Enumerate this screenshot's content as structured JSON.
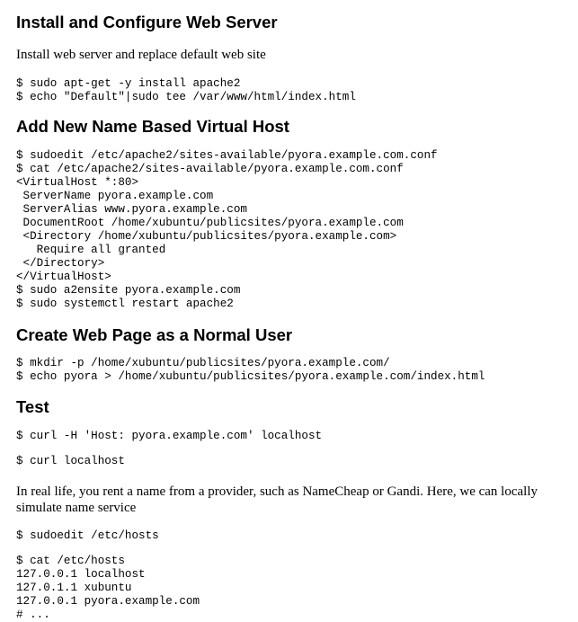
{
  "sections": [
    {
      "heading": "Install and Configure Web Server",
      "intro": "Install web server and replace default web site",
      "code": [
        "$ sudo apt-get -y install apache2",
        "$ echo \"Default\"|sudo tee /var/www/html/index.html"
      ]
    },
    {
      "heading": "Add New Name Based Virtual Host",
      "code": [
        "$ sudoedit /etc/apache2/sites-available/pyora.example.com.conf",
        "$ cat /etc/apache2/sites-available/pyora.example.com.conf",
        "<VirtualHost *:80>",
        " ServerName pyora.example.com",
        " ServerAlias www.pyora.example.com",
        " DocumentRoot /home/xubuntu/publicsites/pyora.example.com",
        " <Directory /home/xubuntu/publicsites/pyora.example.com>",
        "   Require all granted",
        " </Directory>",
        "</VirtualHost>",
        "$ sudo a2ensite pyora.example.com",
        "$ sudo systemctl restart apache2"
      ]
    },
    {
      "heading": "Create Web Page as a Normal User",
      "code": [
        "$ mkdir -p /home/xubuntu/publicsites/pyora.example.com/",
        "$ echo pyora > /home/xubuntu/publicsites/pyora.example.com/index.html"
      ]
    },
    {
      "heading": "Test",
      "code_a": "$ curl -H 'Host: pyora.example.com' localhost",
      "code_b": "$ curl localhost",
      "paragraph": "In real life, you rent a name from a provider, such as NameCheap or Gandi. Here, we can locally simulate name service",
      "code_c": "$ sudoedit /etc/hosts",
      "code_d": [
        "$ cat /etc/hosts",
        "127.0.0.1 localhost",
        "127.0.1.1 xubuntu",
        "127.0.0.1 pyora.example.com",
        "# ..."
      ]
    }
  ]
}
